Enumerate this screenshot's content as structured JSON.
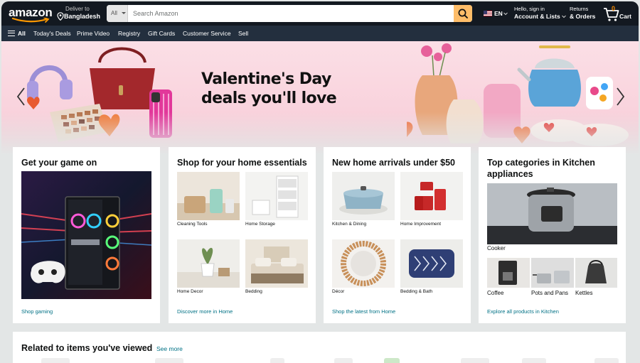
{
  "header": {
    "logo_text": "amazon",
    "deliver_line1": "Deliver to",
    "deliver_line2": "Bangladesh",
    "search_category": "All",
    "search_placeholder": "Search Amazon",
    "language": "EN",
    "account_line1": "Hello, sign in",
    "account_line2": "Account & Lists",
    "orders_line1": "Returns",
    "orders_line2": "& Orders",
    "cart_count": "0",
    "cart_label": "Cart"
  },
  "nav": {
    "all_label": "All",
    "items": [
      "Today's Deals",
      "Prime Video",
      "Registry",
      "Gift Cards",
      "Customer Service",
      "Sell"
    ]
  },
  "hero": {
    "title_line1": "Valentine's Day",
    "title_line2": "deals you'll love"
  },
  "cards": [
    {
      "title": "Get your game on",
      "link": "Shop gaming"
    },
    {
      "title": "Shop for your home essentials",
      "tiles": [
        "Cleaning Tools",
        "Home Storage",
        "Home Decor",
        "Bedding"
      ],
      "link": "Discover more in Home"
    },
    {
      "title": "New home arrivals under $50",
      "tiles": [
        "Kitchen & Dining",
        "Home Improvement",
        "Décor",
        "Bedding & Bath"
      ],
      "link": "Shop the latest from Home"
    },
    {
      "title": "Top categories in Kitchen appliances",
      "main_caption": "Cooker",
      "tiles": [
        "Coffee",
        "Pots and Pans",
        "Kettles"
      ],
      "link": "Explore all products in Kitchen"
    }
  ],
  "related": {
    "title": "Related to items you've viewed",
    "see_more": "See more"
  },
  "colors": {
    "header_bg": "#131921",
    "subnav_bg": "#232f3e",
    "search_button": "#febd69",
    "link": "#007185",
    "cart_count": "#f08804",
    "hero_pink": "#f9d3dd",
    "page_bg": "#e3e6e6"
  },
  "icons": [
    "location-pin-icon",
    "search-icon",
    "us-flag-icon",
    "cart-icon",
    "hamburger-menu-icon",
    "chevron-left-icon",
    "chevron-right-icon"
  ]
}
